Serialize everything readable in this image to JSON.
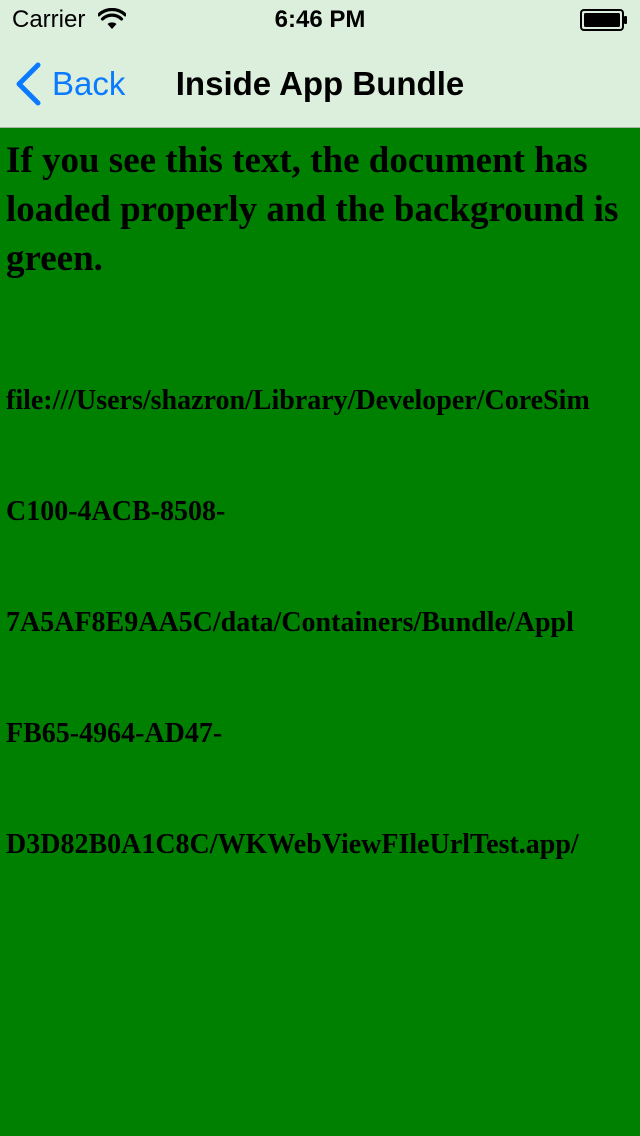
{
  "status_bar": {
    "carrier": "Carrier",
    "time": "6:46 PM",
    "wifi_icon": "wifi-icon",
    "battery_icon": "battery-full-icon"
  },
  "nav_bar": {
    "back_label": "Back",
    "back_icon": "chevron-left-icon",
    "title": "Inside App Bundle",
    "accent_color": "#0a7aff",
    "background_color": "#dcefdc"
  },
  "web_page": {
    "background_color": "#008000",
    "headline": "If you see this text, the document has loaded properly and the background is green.",
    "file_url_lines": [
      "file:///Users/shazron/Library/Developer/CoreSim",
      "C100-4ACB-8508-",
      "7A5AF8E9AA5C/data/Containers/Bundle/Appl",
      "FB65-4964-AD47-",
      "D3D82B0A1C8C/WKWebViewFIleUrlTest.app/"
    ]
  }
}
